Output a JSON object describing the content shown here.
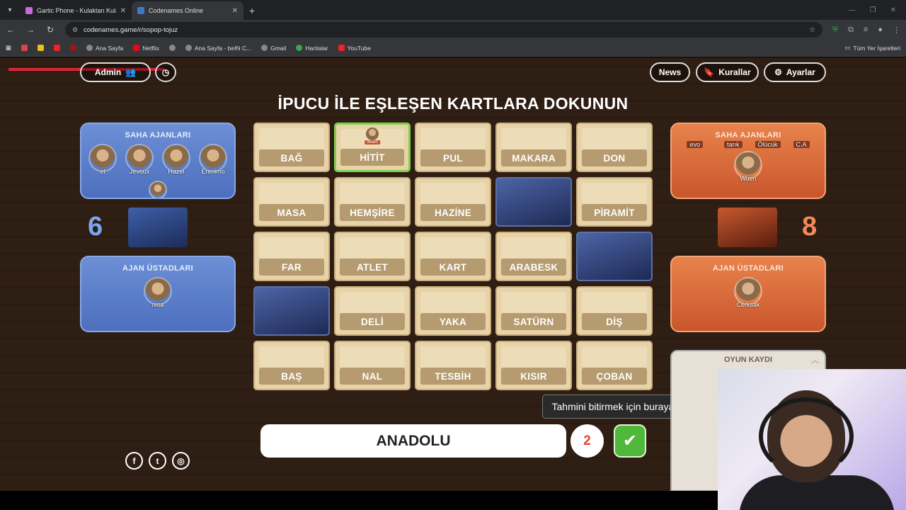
{
  "browser": {
    "tabs": [
      {
        "title": "Gartic Phone - Kulaktan Kulağa",
        "active": false,
        "favicon_color": "#c66bd9"
      },
      {
        "title": "Codenames Online",
        "active": true,
        "favicon_color": "#3f78c9"
      }
    ],
    "url": "codenames.game/r/sopop-tojuz",
    "bookmarks": [
      "Ana Sayfa",
      "Netflix",
      "Ana Sayfa - beIN C...",
      "Gmail",
      "Haritalar",
      "YouTube"
    ],
    "bookmarks_right": "Tüm Yer İşaretleri"
  },
  "header": {
    "admin_label": "Admin",
    "news_label": "News",
    "rules_label": "Kurallar",
    "settings_label": "Ayarlar",
    "headline": "İPUCU İLE EŞLEŞEN KARTLARA DOKUNUN"
  },
  "blue_team": {
    "field_title": "SAHA AJANLARI",
    "field_agents": [
      "et",
      "Jevoux",
      "Hazel",
      "Erenimo"
    ],
    "score": "6",
    "spymaster_title": "AJAN ÜSTADLARI",
    "spymasters": [
      "nisa"
    ]
  },
  "red_team": {
    "field_title": "SAHA AJANLARI",
    "field_agents": [
      "evo",
      "tarık",
      "Ölücük",
      "C.A"
    ],
    "field_agent_featured": "Wuen",
    "score": "8",
    "spymaster_title": "AJAN ÜSTADLARI",
    "spymasters": [
      "Cerksak"
    ]
  },
  "board": {
    "cards": [
      {
        "word": "BAĞ",
        "state": "hidden"
      },
      {
        "word": "HİTİT",
        "state": "selected",
        "marker": "Wuen"
      },
      {
        "word": "PUL",
        "state": "hidden"
      },
      {
        "word": "MAKARA",
        "state": "hidden"
      },
      {
        "word": "DON",
        "state": "hidden"
      },
      {
        "word": "MASA",
        "state": "hidden"
      },
      {
        "word": "HEMŞİRE",
        "state": "hidden"
      },
      {
        "word": "HAZİNE",
        "state": "hidden"
      },
      {
        "word": "",
        "state": "revealed"
      },
      {
        "word": "PİRAMİT",
        "state": "hidden"
      },
      {
        "word": "FAR",
        "state": "hidden"
      },
      {
        "word": "ATLET",
        "state": "hidden"
      },
      {
        "word": "KART",
        "state": "hidden"
      },
      {
        "word": "ARABESK",
        "state": "hidden"
      },
      {
        "word": "",
        "state": "revealed"
      },
      {
        "word": "",
        "state": "revealed"
      },
      {
        "word": "DELİ",
        "state": "hidden"
      },
      {
        "word": "YAKA",
        "state": "hidden"
      },
      {
        "word": "SATÜRN",
        "state": "hidden"
      },
      {
        "word": "DİŞ",
        "state": "hidden"
      },
      {
        "word": "BAŞ",
        "state": "hidden"
      },
      {
        "word": "NAL",
        "state": "hidden"
      },
      {
        "word": "TESBİH",
        "state": "hidden"
      },
      {
        "word": "KISIR",
        "state": "hidden"
      },
      {
        "word": "ÇOBAN",
        "state": "hidden"
      }
    ]
  },
  "clue": {
    "word": "ANADOLU",
    "number": "2",
    "tooltip": "Tahmini bitirmek için buraya tıklayın"
  },
  "log": {
    "title": "OYUN KAYDI"
  },
  "colors": {
    "blue_team": "#5a7fc9",
    "red_team": "#d96a3b",
    "confirm": "#4fb83a"
  }
}
